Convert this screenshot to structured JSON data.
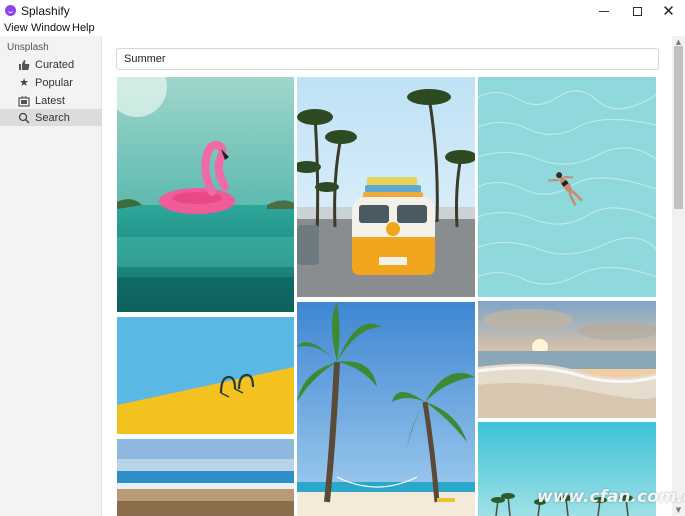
{
  "window": {
    "title": "Splashify"
  },
  "menu": {
    "view": "View",
    "window": "Window",
    "help": "Help"
  },
  "sidebar": {
    "section": "Unsplash",
    "items": [
      {
        "label": "Curated",
        "icon": "thumbs-up-icon"
      },
      {
        "label": "Popular",
        "icon": "star-icon"
      },
      {
        "label": "Latest",
        "icon": "latest-icon"
      },
      {
        "label": "Search",
        "icon": "search-icon",
        "active": true
      }
    ]
  },
  "search": {
    "value": "Summer"
  },
  "watermark": "www.cfan.com.cn",
  "photos": [
    {
      "name": "photo-flamingo-float",
      "subject": "pink flamingo float on turquoise sea"
    },
    {
      "name": "photo-vw-van",
      "subject": "yellow VW van with surfboards under palm trees"
    },
    {
      "name": "photo-swimmer-aerial",
      "subject": "aerial view of swimmer in clear water"
    },
    {
      "name": "photo-pool-ladder",
      "subject": "pool ladder against yellow edge"
    },
    {
      "name": "photo-palm-trees",
      "subject": "palm trees with hammock on beach"
    },
    {
      "name": "photo-beach-sunset",
      "subject": "sunset over beach waves"
    },
    {
      "name": "photo-blurred-beach",
      "subject": "blurred beach shoreline"
    },
    {
      "name": "photo-palm-sky",
      "subject": "palm trees under blue sky"
    }
  ],
  "colors": {
    "accent": "#8e44ec",
    "sidebar_active": "#dcdcdc"
  }
}
